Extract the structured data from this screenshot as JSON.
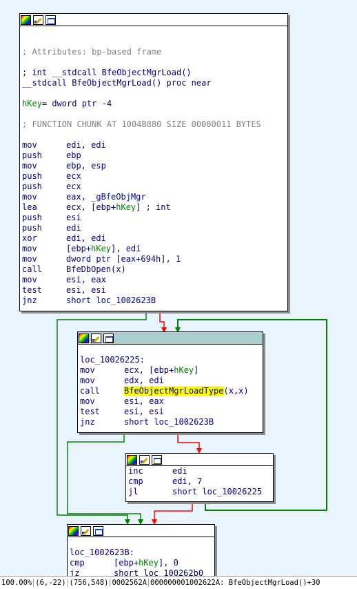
{
  "node1": {
    "attributes": "; Attributes: bp-based frame",
    "proto1": "; int __stdcall BfeObjectMgrLoad()",
    "proto2_a": "__stdcall BfeObjectMgrLoad()",
    "proto2_b": " proc near",
    "var_name": "hKey",
    "var_def": "= dword ptr -4",
    "chunk": "; FUNCTION CHUNK AT 1004B880 SIZE 00000011 BYTES",
    "instructions": [
      {
        "m": "mov",
        "o": "edi, edi"
      },
      {
        "m": "push",
        "o": "ebp"
      },
      {
        "m": "mov",
        "o": "ebp, esp"
      },
      {
        "m": "push",
        "o": "ecx"
      },
      {
        "m": "push",
        "o": "ecx"
      },
      {
        "m": "mov",
        "o": "eax, _gBfeObjMgr"
      },
      {
        "m": "lea",
        "o1": "ecx, [ebp+",
        "v": "hKey",
        "o2": "] ; int"
      },
      {
        "m": "push",
        "o": "esi"
      },
      {
        "m": "push",
        "o": "edi"
      },
      {
        "m": "xor",
        "o": "edi, edi"
      },
      {
        "m": "mov",
        "o1": "[ebp+",
        "v": "hKey",
        "o2": "], edi"
      },
      {
        "m": "mov",
        "o": "dword ptr [eax+694h], 1"
      },
      {
        "m": "call",
        "o": "BfeDbOpen(x)"
      },
      {
        "m": "mov",
        "o": "esi, eax"
      },
      {
        "m": "test",
        "o": "esi, esi"
      },
      {
        "m": "jnz",
        "o": "short loc_1002623B"
      }
    ]
  },
  "node2": {
    "label": "loc_10026225:",
    "instructions": [
      {
        "m": "mov",
        "o1": "ecx, [ebp+",
        "v": "hKey",
        "o2": "]"
      },
      {
        "m": "mov",
        "o": "edx, edi"
      },
      {
        "m": "call",
        "hl": "BfeObjectMgrLoadType",
        "o2": "(x,x)"
      },
      {
        "m": "mov",
        "o": "esi, eax"
      },
      {
        "m": "test",
        "o": "esi, esi"
      },
      {
        "m": "jnz",
        "o": "short loc_1002623B"
      }
    ]
  },
  "node3": {
    "instructions": [
      {
        "m": "inc",
        "o": "edi"
      },
      {
        "m": "cmp",
        "o": "edi, 7"
      },
      {
        "m": "jl",
        "o": "short loc_10026225"
      }
    ]
  },
  "node4": {
    "label": "loc_1002623B:",
    "instructions": [
      {
        "m": "cmp",
        "o1": "[ebp+",
        "v": "hKey",
        "o2": "], 0"
      },
      {
        "m": "jz",
        "o": "short loc_100262b0"
      }
    ]
  },
  "status": {
    "zoom": "100.00%",
    "mouse": "(6,-22)",
    "graph_pos": "(756,548)",
    "file_offset": "0002562A",
    "address": "000000001002622A: BfeObjectMgrLoad()+30"
  },
  "colors": {
    "background": "#eaf4fc",
    "edge_true": "#008000",
    "edge_false": "#ff0000",
    "edge_unconditional": "#008000",
    "selected_header": "#a9d0d1"
  },
  "icons": [
    "color-palette-icon",
    "rename-pencil-icon",
    "graph-overview-icon"
  ]
}
